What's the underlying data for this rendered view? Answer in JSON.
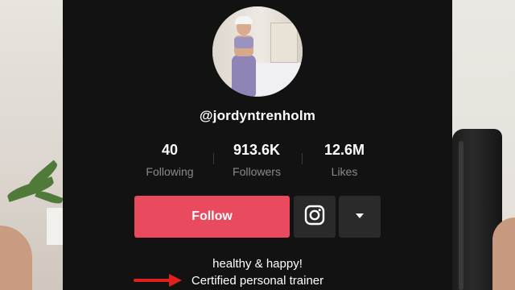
{
  "profile": {
    "username": "@jordyntrenholm",
    "stats": [
      {
        "value": "40",
        "label": "Following"
      },
      {
        "value": "913.6K",
        "label": "Followers"
      },
      {
        "value": "12.6M",
        "label": "Likes"
      }
    ],
    "follow_label": "Follow",
    "bio_lines": [
      "healthy & happy!",
      "Certified personal trainer"
    ]
  },
  "icons": {
    "instagram": "instagram-icon",
    "more": "chevron-down-icon",
    "annotation": "red-arrow-icon"
  },
  "colors": {
    "panel_bg": "#121212",
    "follow": "#ea4a5d",
    "secondary_btn": "#2a2a2a",
    "muted_text": "#8a8a8a",
    "annotation_arrow": "#e0201b"
  }
}
